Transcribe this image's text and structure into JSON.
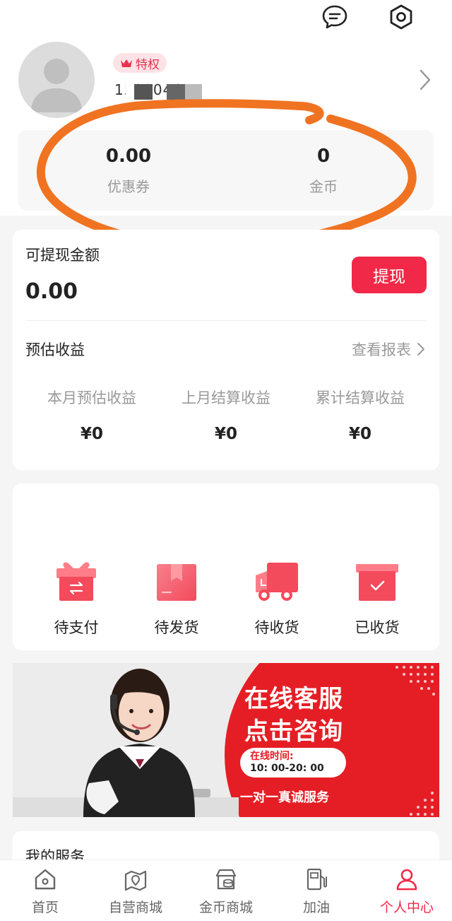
{
  "header": {
    "message_icon": "message-icon",
    "settings_icon": "settings-hexagon-icon"
  },
  "profile": {
    "badge_label": "特权",
    "badge_icon": "crown-icon",
    "phone_masked": "1502046",
    "arrow_icon": "chevron-right-icon"
  },
  "stats": [
    {
      "value": "0.00",
      "label": "优惠券"
    },
    {
      "value": "0",
      "label": "金币"
    }
  ],
  "earnings": {
    "withdraw_title": "可提现金额",
    "withdraw_amount": "0.00",
    "withdraw_button": "提现",
    "estimate_title": "预估收益",
    "report_link": "查看报表",
    "columns": [
      {
        "label": "本月预估收益",
        "value": "¥0"
      },
      {
        "label": "上月结算收益",
        "value": "¥0"
      },
      {
        "label": "累计结算收益",
        "value": "¥0"
      }
    ]
  },
  "orders": [
    {
      "label": "待支付",
      "icon": "gift-icon"
    },
    {
      "label": "待发货",
      "icon": "package-icon"
    },
    {
      "label": "待收货",
      "icon": "truck-icon"
    },
    {
      "label": "已收货",
      "icon": "received-box-icon"
    }
  ],
  "banner": {
    "title_line1": "在线客服",
    "title_line2": "点击咨询",
    "hours_label": "在线时间:",
    "hours_value": "10: 00-20: 00",
    "slogan": "一对一真诚服务"
  },
  "services": {
    "title": "我的服务"
  },
  "tabbar": {
    "active": "个人中心",
    "colors": {
      "active": "#f22848",
      "inactive": "#666666"
    },
    "items": [
      {
        "label": "首页",
        "icon": "home-icon"
      },
      {
        "label": "自营商城",
        "icon": "map-store-icon"
      },
      {
        "label": "金币商城",
        "icon": "coin-store-icon"
      },
      {
        "label": "加油",
        "icon": "fuel-icon"
      },
      {
        "label": "个人中心",
        "icon": "person-icon"
      }
    ]
  },
  "colors": {
    "accent": "#f22848",
    "annotation": "#f07322",
    "banner_red": "#e51e25"
  }
}
